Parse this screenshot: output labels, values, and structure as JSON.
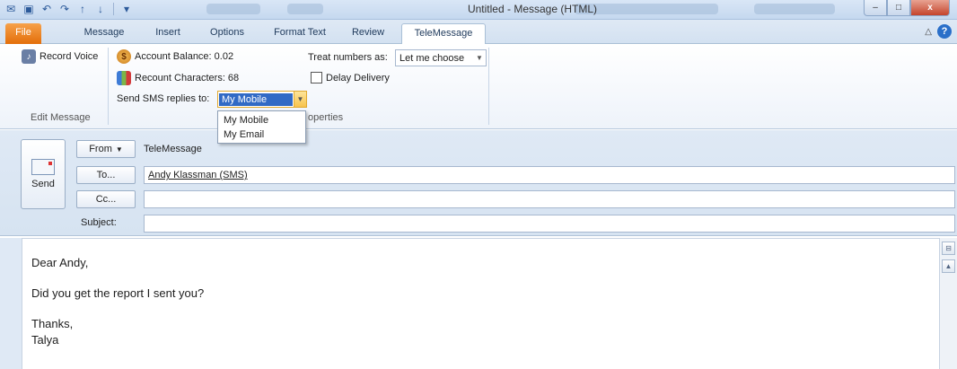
{
  "window": {
    "title": "Untitled  -  Message (HTML)",
    "controls": {
      "minimize": "–",
      "maximize": "□",
      "close": "x"
    }
  },
  "qat": {
    "save_icon": "save-icon",
    "undo_icon": "undo-icon",
    "redo_icon": "redo-icon",
    "customize": "▾"
  },
  "tabs": [
    {
      "label": "File"
    },
    {
      "label": "Message"
    },
    {
      "label": "Insert"
    },
    {
      "label": "Options"
    },
    {
      "label": "Format Text"
    },
    {
      "label": "Review"
    },
    {
      "label": "TeleMessage"
    }
  ],
  "ribbon": {
    "record_voice": "Record Voice",
    "edit_message_group": "Edit Message",
    "account_balance": "Account Balance: 0.02",
    "recount_characters": "Recount Characters: 68",
    "send_sms_label": "Send SMS replies to:",
    "send_sms_value": "My Mobile",
    "treat_numbers_label": "Treat numbers as:",
    "treat_numbers_value": "Let me choose",
    "delay_delivery": "Delay Delivery",
    "properties_group": "operties"
  },
  "dropdown": {
    "options": [
      "My Mobile",
      "My Email"
    ]
  },
  "header": {
    "send_label": "Send",
    "from_button": "From",
    "from_value": "TeleMessage",
    "to_button": "To...",
    "to_value": "Andy Klassman (SMS)",
    "cc_button": "Cc...",
    "cc_value": "",
    "subject_label": "Subject:",
    "subject_value": ""
  },
  "body": {
    "lines": [
      "Dear Andy,",
      "Did you get the report I sent you?",
      "Thanks,",
      "Talya"
    ]
  },
  "colors": {
    "file_tab": "#e36e0a",
    "selection": "#316ac5",
    "ribbon_bg": "#dfe9f5"
  }
}
